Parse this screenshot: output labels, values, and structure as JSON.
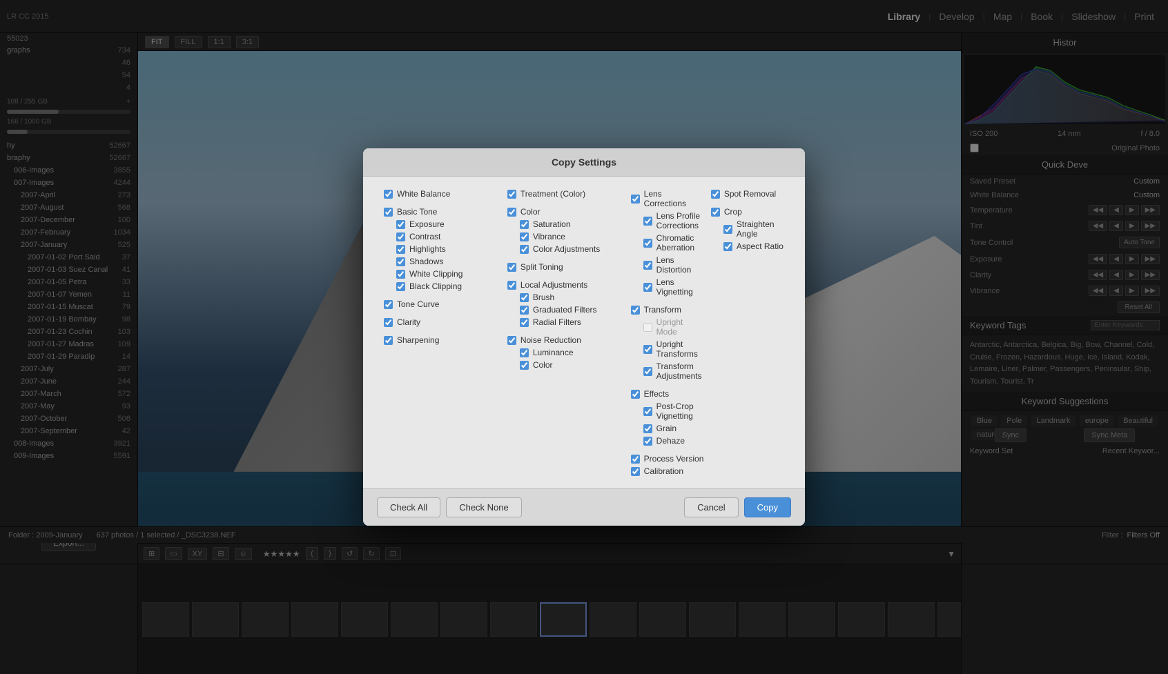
{
  "app": {
    "title": "LR CC 2015",
    "nav": [
      "Library",
      "Develop",
      "Map",
      "Book",
      "Slideshow",
      "Print"
    ],
    "active_nav": "Library"
  },
  "left_sidebar": {
    "stat_photos": "55023",
    "items": [
      {
        "label": "graphs",
        "count": "734"
      },
      {
        "label": "",
        "count": "46"
      },
      {
        "label": "",
        "count": "54"
      },
      {
        "label": "",
        "count": "4"
      }
    ],
    "disk_used": "108 / 255 GB",
    "disk_pct": 42,
    "disk2_used": "166 / 1000 GB",
    "disk2_pct": 17,
    "folders": [
      {
        "label": "hy",
        "count": "52667"
      },
      {
        "label": "braphy",
        "count": "52667"
      },
      {
        "label": "006-Images",
        "count": "3855"
      },
      {
        "label": "007-Images",
        "count": "4244"
      },
      {
        "label": "2007-April",
        "count": "273"
      },
      {
        "label": "2007-August",
        "count": "568"
      },
      {
        "label": "2007-December",
        "count": "100"
      },
      {
        "label": "2007-February",
        "count": "1034"
      },
      {
        "label": "2007-January",
        "count": "525"
      },
      {
        "label": "2007-01-02 Port Said",
        "count": "37"
      },
      {
        "label": "2007-01-03 Suez Canal",
        "count": "41"
      },
      {
        "label": "2007-01-05 Petra",
        "count": "33"
      },
      {
        "label": "2007-01-07 Yemen",
        "count": "11"
      },
      {
        "label": "2007-01-15 Muscat",
        "count": "79"
      },
      {
        "label": "2007-01-19 Bombay",
        "count": "98"
      },
      {
        "label": "2007-01-23 Cochin",
        "count": "103"
      },
      {
        "label": "2007-01-27 Madras",
        "count": "109"
      },
      {
        "label": "2007-01-29 Paradip",
        "count": "14"
      },
      {
        "label": "2007-July",
        "count": "287"
      },
      {
        "label": "2007-June",
        "count": "244"
      },
      {
        "label": "2007-March",
        "count": "572"
      },
      {
        "label": "2007-May",
        "count": "93"
      },
      {
        "label": "2007-October",
        "count": "506"
      },
      {
        "label": "2007-September",
        "count": "42"
      },
      {
        "label": "008-Images",
        "count": "3921"
      },
      {
        "label": "009-Images",
        "count": "5591"
      }
    ]
  },
  "right_sidebar": {
    "histogram_label": "Histor",
    "iso": "ISO 200",
    "focal": "14 mm",
    "aperture": "f / 8.0",
    "original_photo": "Original Photo",
    "quick_deve_label": "Quick Deve",
    "saved_preset_label": "Saved Preset",
    "saved_preset_value": "Custom",
    "white_balance_label": "White Balance",
    "white_balance_value": "Custom",
    "temperature_label": "Temperature",
    "tint_label": "Tint",
    "tone_control_label": "Tone Control",
    "tone_control_value": "Auto Tone",
    "exposure_label": "Exposure",
    "clarity_label": "Clarity",
    "vibrance_label": "Vibrance",
    "reset_label": "Reset All",
    "keyword_tags_label": "Keyword Tags",
    "keyword_tags_placeholder": "Enter Keywords",
    "keywords": "Antarctic, Antarctica, Belgica, Big, Bow, Channel, Cold, Cruise, Frozen, Hazardous, Huge, Ice, Island, Kodak, Lemaire, Liner, Palmer, Passengers, Peninsular, Ship, Tourism, Tourist, Tr",
    "keyword_suggestions_label": "Keyword Suggestions",
    "suggestions": [
      "Blue",
      "Pole",
      "Landmark",
      "europe",
      "Beautiful",
      "nature"
    ],
    "keyword_set_label": "Keyword Set",
    "recent_keywords_label": "Recent Keywor...",
    "sync_label": "Sync",
    "sync_meta_label": "Sync Meta"
  },
  "modal": {
    "title": "Copy Settings",
    "col1": [
      {
        "label": "White Balance",
        "checked": true,
        "indent": 0
      },
      {
        "label": "Basic Tone",
        "checked": true,
        "indent": 0
      },
      {
        "label": "Exposure",
        "checked": true,
        "indent": 1
      },
      {
        "label": "Contrast",
        "checked": true,
        "indent": 1
      },
      {
        "label": "Highlights",
        "checked": true,
        "indent": 1
      },
      {
        "label": "Shadows",
        "checked": true,
        "indent": 1
      },
      {
        "label": "White Clipping",
        "checked": true,
        "indent": 1
      },
      {
        "label": "Black Clipping",
        "checked": true,
        "indent": 1
      },
      {
        "label": "Tone Curve",
        "checked": true,
        "indent": 0
      },
      {
        "label": "Clarity",
        "checked": true,
        "indent": 0
      },
      {
        "label": "Sharpening",
        "checked": true,
        "indent": 0
      }
    ],
    "col2": [
      {
        "label": "Treatment (Color)",
        "checked": true,
        "indent": 0
      },
      {
        "label": "Color",
        "checked": true,
        "indent": 0
      },
      {
        "label": "Saturation",
        "checked": true,
        "indent": 1
      },
      {
        "label": "Vibrance",
        "checked": true,
        "indent": 1
      },
      {
        "label": "Color Adjustments",
        "checked": true,
        "indent": 1
      },
      {
        "label": "Split Toning",
        "checked": true,
        "indent": 0
      },
      {
        "label": "Local Adjustments",
        "checked": true,
        "indent": 0
      },
      {
        "label": "Brush",
        "checked": true,
        "indent": 1
      },
      {
        "label": "Graduated Filters",
        "checked": true,
        "indent": 1
      },
      {
        "label": "Radial Filters",
        "checked": true,
        "indent": 1
      },
      {
        "label": "Noise Reduction",
        "checked": true,
        "indent": 0
      },
      {
        "label": "Luminance",
        "checked": true,
        "indent": 1
      },
      {
        "label": "Color",
        "checked": true,
        "indent": 1
      }
    ],
    "col3_left": [
      {
        "label": "Lens Corrections",
        "checked": true,
        "indent": 0
      },
      {
        "label": "Lens Profile Corrections",
        "checked": true,
        "indent": 1
      },
      {
        "label": "Chromatic Aberration",
        "checked": true,
        "indent": 1
      },
      {
        "label": "Lens Distortion",
        "checked": true,
        "indent": 1
      },
      {
        "label": "Lens Vignetting",
        "checked": true,
        "indent": 1
      },
      {
        "label": "Transform",
        "checked": true,
        "indent": 0
      },
      {
        "label": "Upright Mode",
        "checked": false,
        "indent": 1,
        "disabled": true
      },
      {
        "label": "Upright Transforms",
        "checked": true,
        "indent": 1
      },
      {
        "label": "Transform Adjustments",
        "checked": true,
        "indent": 1
      },
      {
        "label": "Effects",
        "checked": true,
        "indent": 0
      },
      {
        "label": "Post-Crop Vignetting",
        "checked": true,
        "indent": 1
      },
      {
        "label": "Grain",
        "checked": true,
        "indent": 1
      },
      {
        "label": "Dehaze",
        "checked": true,
        "indent": 1
      },
      {
        "label": "Process Version",
        "checked": true,
        "indent": 0
      },
      {
        "label": "Calibration",
        "checked": true,
        "indent": 0
      }
    ],
    "col3_right": [
      {
        "label": "Spot Removal",
        "checked": true,
        "indent": 0
      },
      {
        "label": "Crop",
        "checked": true,
        "indent": 0
      },
      {
        "label": "Straighten Angle",
        "checked": true,
        "indent": 1
      },
      {
        "label": "Aspect Ratio",
        "checked": true,
        "indent": 1
      }
    ],
    "check_all_label": "Check All",
    "check_none_label": "Check None",
    "cancel_label": "Cancel",
    "copy_label": "Copy"
  },
  "folder_bar": {
    "folder_label": "Folder : 2009-January",
    "photos_label": "637 photos / 1 selected / _DSC3238.NEF",
    "filter_label": "Filter :",
    "filter_value": "Filters Off"
  },
  "view_toolbar": {
    "fit_label": "FIT",
    "fill_label": "FILL",
    "ratio1": "1:1",
    "ratio2": "3:1"
  },
  "export_btn": "Export...",
  "filmstrip_thumbs_count": 20
}
